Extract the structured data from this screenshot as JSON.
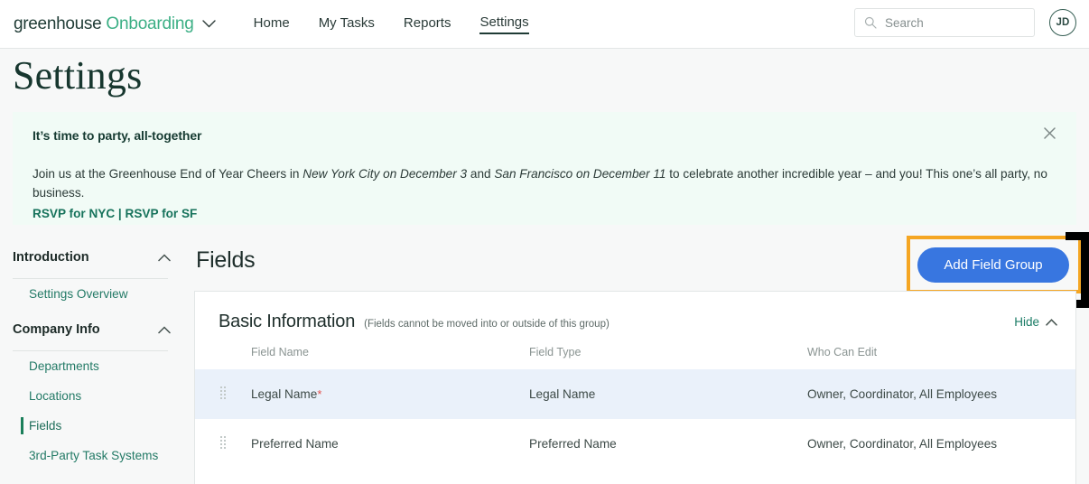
{
  "topnav": {
    "brand_word": "greenhouse",
    "brand_product": "Onboarding",
    "brand_chevron_icon": "chevron-down-icon",
    "links": [
      {
        "label": "Home",
        "active": false
      },
      {
        "label": "My Tasks",
        "active": false
      },
      {
        "label": "Reports",
        "active": false
      },
      {
        "label": "Settings",
        "active": true
      }
    ],
    "search": {
      "icon": "search-icon",
      "placeholder": "Search",
      "value": ""
    },
    "avatar_initials": "JD"
  },
  "page": {
    "title": "Settings"
  },
  "banner": {
    "title": "It’s time to party, all-together",
    "body_part1": "Join us at the Greenhouse End of Year Cheers in ",
    "body_em1": "New York City on December 3",
    "body_part2": " and ",
    "body_em2": "San Francisco on December 11",
    "body_part3": " to celebrate another incredible year – and you! This one’s all party, no business.",
    "link_nyc": "RSVP for NYC",
    "link_sep": " | ",
    "link_sf": "RSVP for SF",
    "close_icon": "close-icon",
    "background_color": "#f1fbf6"
  },
  "sidebar": {
    "groups": [
      {
        "title": "Introduction",
        "chevron_icon": "chevron-up-icon",
        "items": [
          {
            "label": "Settings Overview",
            "active": false
          }
        ]
      },
      {
        "title": "Company Info",
        "chevron_icon": "chevron-up-icon",
        "items": [
          {
            "label": "Departments",
            "active": false
          },
          {
            "label": "Locations",
            "active": false
          },
          {
            "label": "Fields",
            "active": true
          },
          {
            "label": "3rd-Party Task Systems",
            "active": false
          }
        ]
      }
    ]
  },
  "main": {
    "heading": "Fields",
    "add_button_label": "Add Field Group",
    "add_button_color": "#3876e0",
    "highlight_color": "#f5a623",
    "card": {
      "title": "Basic Information",
      "note": "(Fields cannot be moved into or outside of this group)",
      "hide_label": "Hide",
      "hide_chevron_icon": "chevron-up-icon",
      "columns": [
        "Field Name",
        "Field Type",
        "Who Can Edit"
      ],
      "rows": [
        {
          "handle_icon": "drag-handle-icon",
          "field_name": "Legal Name",
          "required": true,
          "required_marker": "*",
          "field_type": "Legal Name",
          "who_can_edit": "Owner, Coordinator, All Employees",
          "highlighted": true
        },
        {
          "handle_icon": "drag-handle-icon",
          "field_name": "Preferred Name",
          "required": false,
          "required_marker": "",
          "field_type": "Preferred Name",
          "who_can_edit": "Owner, Coordinator, All Employees",
          "highlighted": false
        }
      ]
    }
  }
}
